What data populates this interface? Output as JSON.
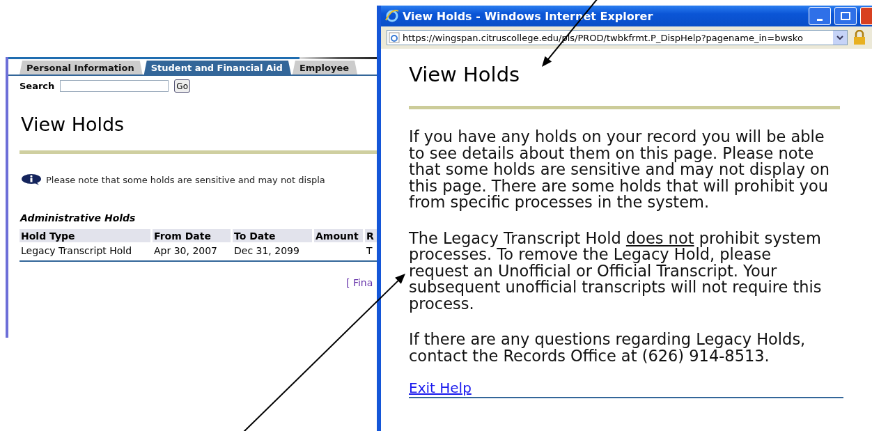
{
  "background_page": {
    "tabs": [
      {
        "label": "Personal Information",
        "selected": false
      },
      {
        "label": "Student and Financial Aid",
        "selected": true
      },
      {
        "label": "Employee",
        "selected": false
      }
    ],
    "search": {
      "label": "Search",
      "button": "Go"
    },
    "title": "View Holds",
    "note": "Please note that some holds are sensitive and may not displa",
    "section_title": "Administrative Holds",
    "table": {
      "columns": [
        "Hold Type",
        "From Date",
        "To Date",
        "Amount",
        "R"
      ],
      "rows": [
        {
          "hold_type": "Legacy Transcript Hold",
          "from_date": "Apr 30, 2007",
          "to_date": "Dec 31, 2099",
          "column_5": "T"
        }
      ]
    },
    "footer_link": "[ Fina"
  },
  "popup": {
    "window_title": "View Holds - Windows Internet Explorer",
    "address": "https://wingspan.citruscollege.edu/pls/PROD/twbkfrmt.P_DispHelp?pagename_in=bwsko",
    "title": "View Holds",
    "paragraphs": [
      [
        {
          "text": "If you have any holds on your record you will be able to see details about them on this page. Please note that some holds are sensitive and may not display on this page. There are some holds that will prohibit you from specific processes in the system.",
          "underline": false
        }
      ],
      [
        {
          "text": "The Legacy Transcript Hold ",
          "underline": false
        },
        {
          "text": "does not",
          "underline": true
        },
        {
          "text": " prohibit system processes. To remove the Legacy Hold, please request an Unofficial or Official Transcript. Your subsequent unofficial transcripts will not require this process.",
          "underline": false
        }
      ],
      [
        {
          "text": "If there are any questions regarding Legacy Holds, contact the Records Office at (626) 914-8513.",
          "underline": false
        }
      ]
    ],
    "exit_link": "Exit Help"
  }
}
